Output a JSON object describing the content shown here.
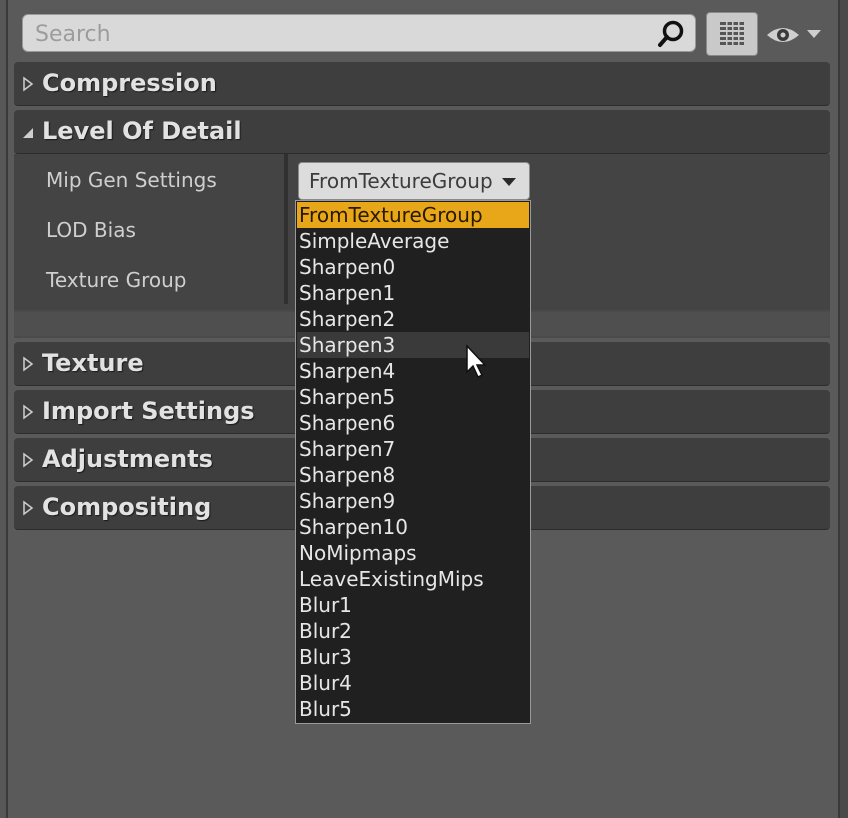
{
  "search": {
    "placeholder": "Search",
    "value": ""
  },
  "categories": {
    "compression": "Compression",
    "level_of_detail": "Level Of Detail",
    "texture": "Texture",
    "import_settings": "Import Settings",
    "adjustments": "Adjustments",
    "compositing": "Compositing"
  },
  "lod": {
    "mip_gen_label": "Mip Gen Settings",
    "lod_bias_label": "LOD Bias",
    "texture_group_label": "Texture Group",
    "mip_gen_value": "FromTextureGroup"
  },
  "menu": {
    "options": [
      "FromTextureGroup",
      "SimpleAverage",
      "Sharpen0",
      "Sharpen1",
      "Sharpen2",
      "Sharpen3",
      "Sharpen4",
      "Sharpen5",
      "Sharpen6",
      "Sharpen7",
      "Sharpen8",
      "Sharpen9",
      "Sharpen10",
      "NoMipmaps",
      "LeaveExistingMips",
      "Blur1",
      "Blur2",
      "Blur3",
      "Blur4",
      "Blur5"
    ],
    "selected": "FromTextureGroup",
    "hovered": "Sharpen3"
  },
  "icons": {
    "search": "search-icon",
    "view_options": "grid-icon",
    "visibility": "eye-icon",
    "collapsed": "triangle-right-icon",
    "expanded": "triangle-down-icon"
  },
  "colors": {
    "selected": "#e8a718",
    "panel": "#3e3e3e",
    "background": "#575757"
  }
}
